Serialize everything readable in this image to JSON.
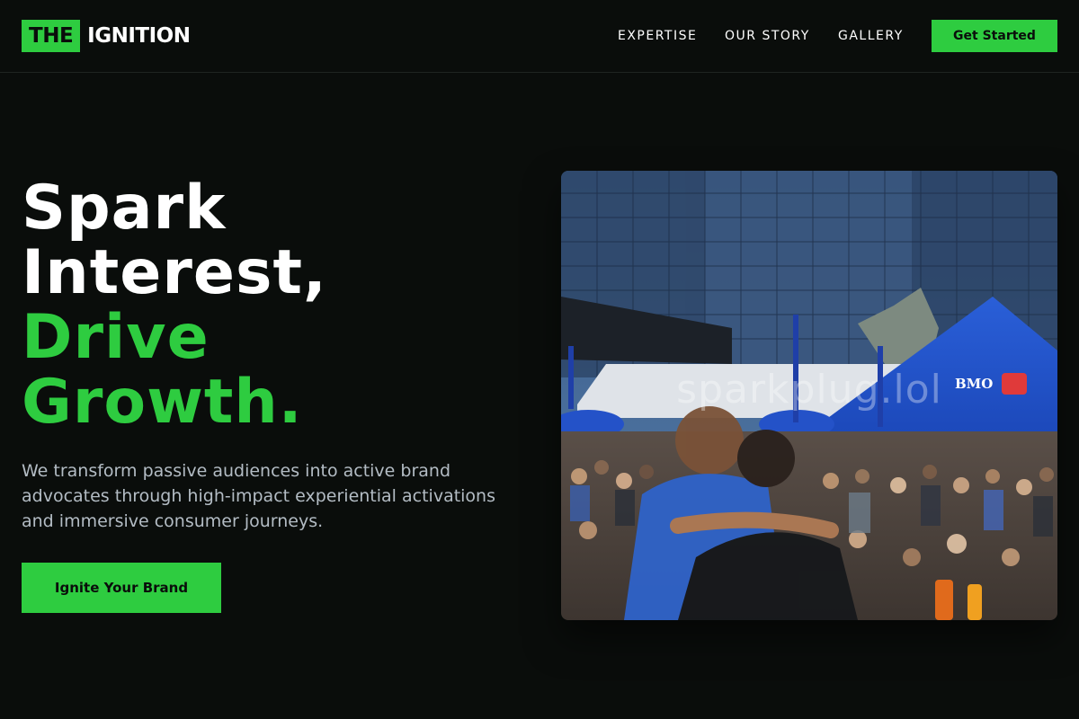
{
  "brand": {
    "logo_box_text": "THE",
    "logo_text": "IGNITION",
    "accent_color": "#2ecc40"
  },
  "nav": {
    "items": [
      {
        "label": "EXPERTISE"
      },
      {
        "label": "OUR STORY"
      },
      {
        "label": "GALLERY"
      }
    ],
    "cta_label": "Get Started"
  },
  "hero": {
    "headline": {
      "line1": "Spark",
      "line2": "Interest,",
      "line3": "Drive",
      "line4": "Growth."
    },
    "subtext": "We transform passive audiences into active brand advocates through high-impact experiential activations and immersive consumer journeys.",
    "cta_label": "Ignite Your Brand",
    "photo": {
      "watermark": "sparkplug.lol",
      "tent_brand": "BMO"
    }
  }
}
